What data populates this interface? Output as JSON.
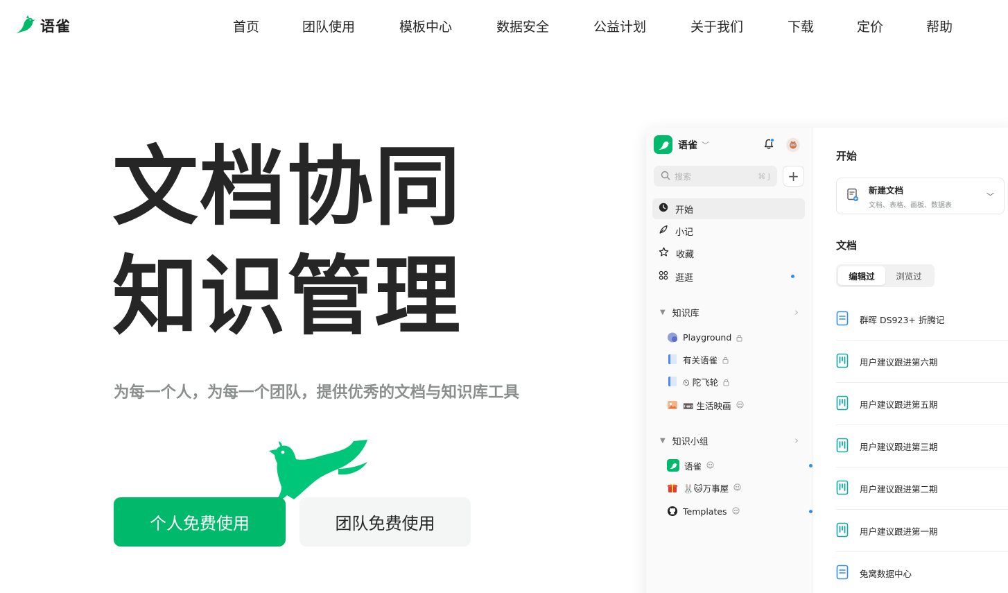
{
  "brand": {
    "name": "语雀",
    "color": "#00b96b"
  },
  "nav": [
    "首页",
    "团队使用",
    "模板中心",
    "数据安全",
    "公益计划",
    "关于我们",
    "下载",
    "定价",
    "帮助"
  ],
  "hero": {
    "title_line1": "文档协同",
    "title_line2": "知识管理",
    "subtitle": "为每一个人，为每一个团队，提供优秀的文档与知识库工具",
    "primary_button": "个人免费使用",
    "secondary_button": "团队免费使用"
  },
  "app": {
    "brand_name": "语雀",
    "search": {
      "placeholder": "搜索",
      "shortcut": "⌘ J"
    },
    "menu": [
      {
        "label": "开始",
        "icon": "clock-icon",
        "active": true
      },
      {
        "label": "小记",
        "icon": "feather-icon"
      },
      {
        "label": "收藏",
        "icon": "star-icon"
      },
      {
        "label": "逛逛",
        "icon": "grid-icon",
        "dot": true
      }
    ],
    "library_section": {
      "label": "知识库",
      "items": [
        {
          "label": "Playground",
          "icon": "playground-icon",
          "badge": "lock"
        },
        {
          "label": "有关语雀",
          "icon": "book-icon",
          "badge": "lock"
        },
        {
          "label": "⏲ 陀飞轮",
          "icon": "book-icon",
          "badge": "lock"
        },
        {
          "label": "📼 生活映画",
          "icon": "photo-icon",
          "badge": "group"
        }
      ]
    },
    "group_section": {
      "label": "知识小组",
      "items": [
        {
          "label": "语雀",
          "icon": "yuque-group-icon",
          "badge": "group",
          "dot": true
        },
        {
          "label": "🐰🐱万事屋",
          "icon": "gift-icon",
          "badge": "group"
        },
        {
          "label": "Templates",
          "icon": "github-icon",
          "badge": "group",
          "dot": true
        }
      ]
    },
    "main": {
      "start_heading": "开始",
      "new_doc": {
        "title": "新建文档",
        "subtitle": "文档、表格、画板、数据表"
      },
      "docs_heading": "文档",
      "tabs": [
        {
          "label": "编辑过",
          "selected": true
        },
        {
          "label": "浏览过",
          "selected": false
        }
      ],
      "docs": [
        {
          "title": "群晖 DS923+ 折腾记",
          "icon": "doc-icon"
        },
        {
          "title": "用户建议跟进第六期",
          "icon": "board-icon"
        },
        {
          "title": "用户建议跟进第五期",
          "icon": "board-icon"
        },
        {
          "title": "用户建议跟进第三期",
          "icon": "board-icon"
        },
        {
          "title": "用户建议跟进第二期",
          "icon": "board-icon"
        },
        {
          "title": "用户建议跟进第一期",
          "icon": "board-icon"
        },
        {
          "title": "兔窝数据中心",
          "icon": "doc-icon"
        }
      ]
    }
  }
}
